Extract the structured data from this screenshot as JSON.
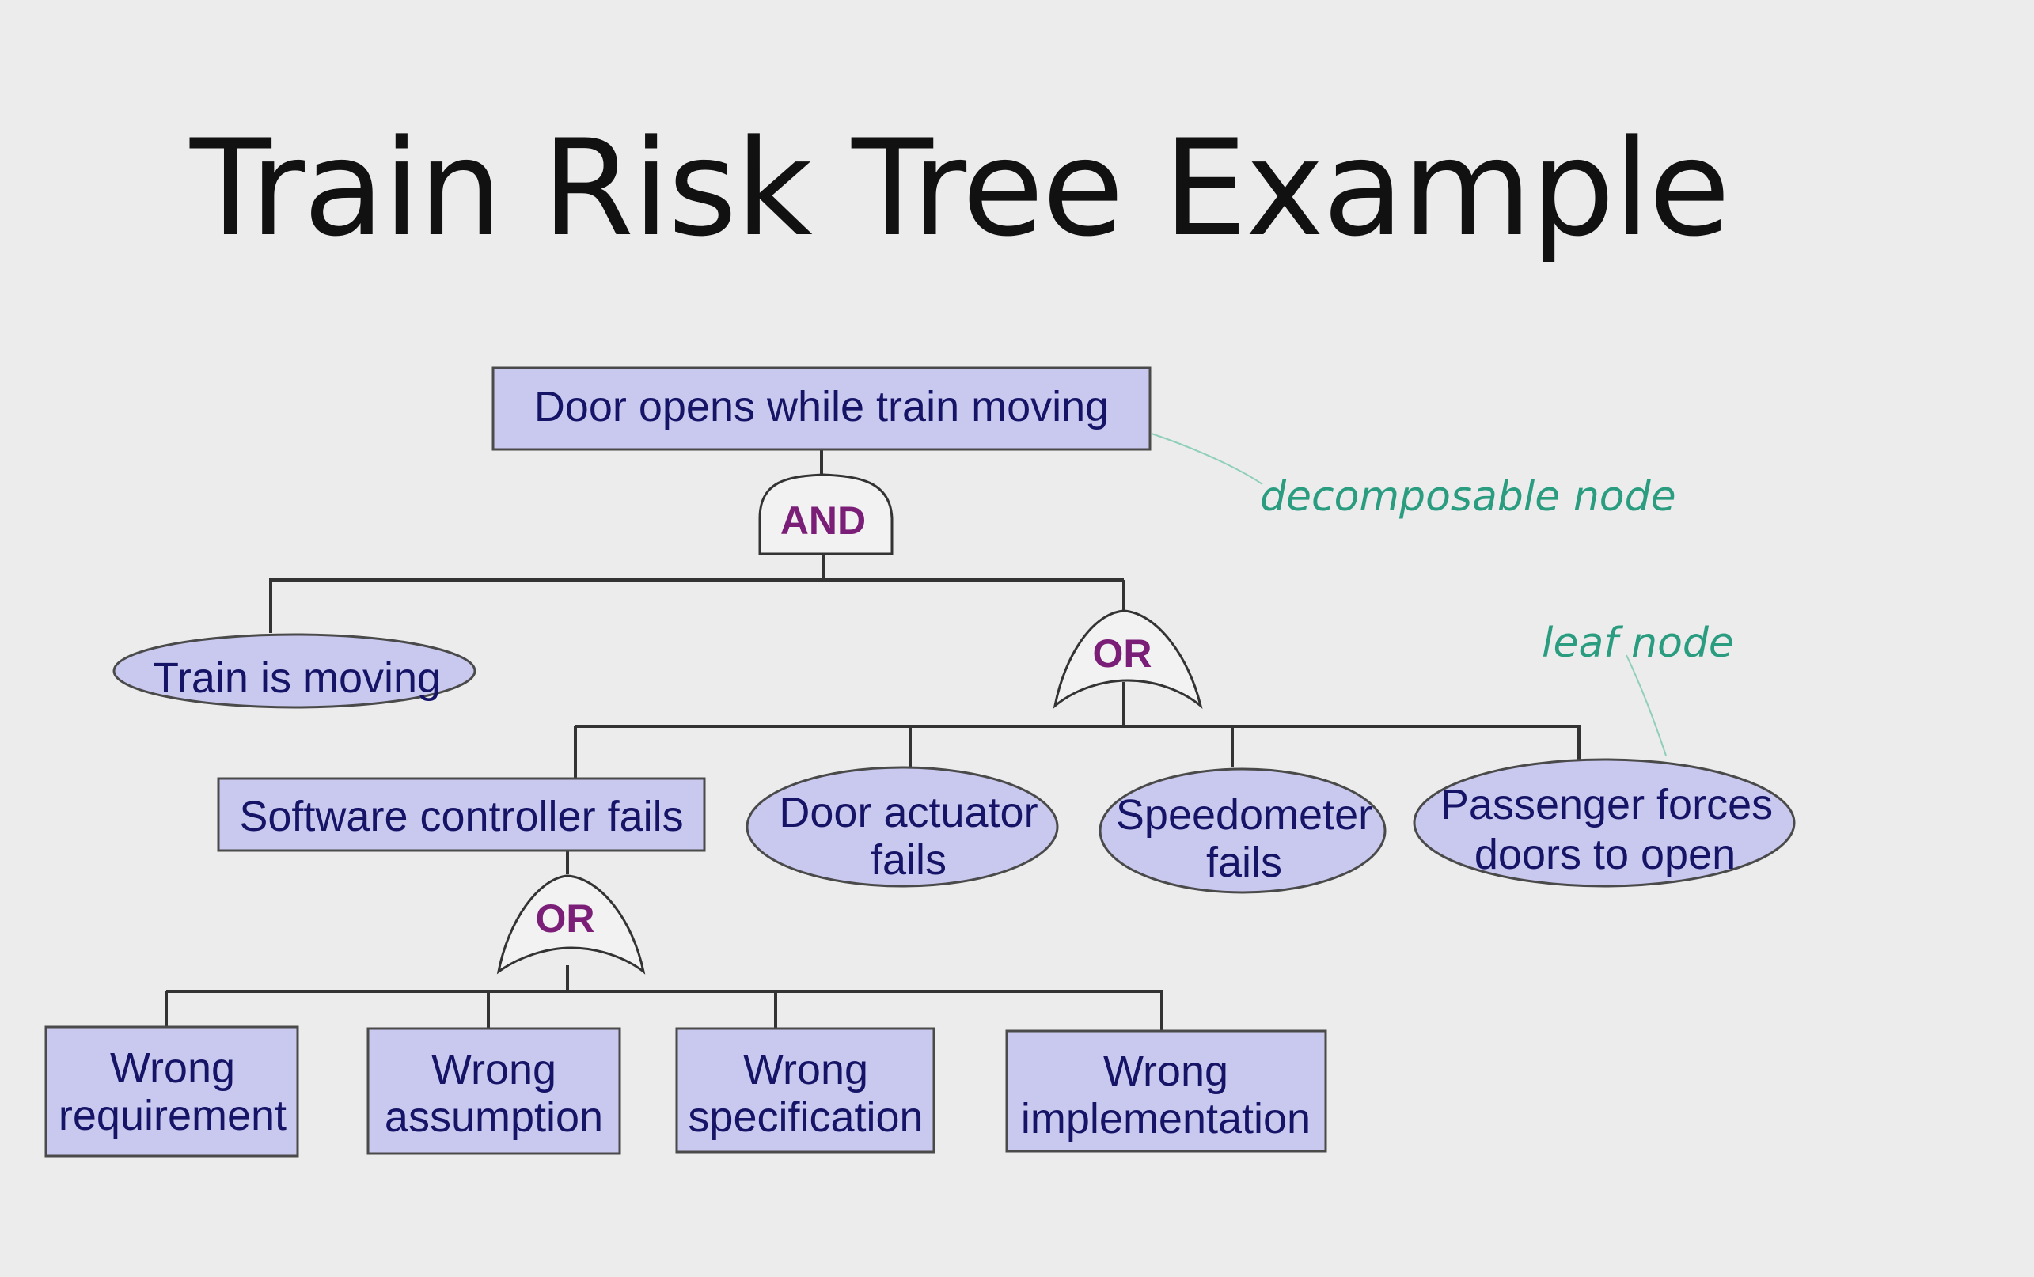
{
  "title": "Train Risk Tree Example",
  "tree": {
    "root": "Door opens while train moving",
    "gate_and": "AND",
    "gate_or_top": "OR",
    "gate_or_software": "OR",
    "train_moving": "Train is moving",
    "software_fails": "Software controller fails",
    "door_actuator": [
      "Door actuator",
      "fails"
    ],
    "speedometer": [
      "Speedometer",
      "fails"
    ],
    "passenger": [
      "Passenger forces",
      "doors to open"
    ],
    "wrong_requirement": [
      "Wrong",
      "requirement"
    ],
    "wrong_assumption": [
      "Wrong",
      "assumption"
    ],
    "wrong_specification": [
      "Wrong",
      "specification"
    ],
    "wrong_implementation": [
      "Wrong",
      "implementation"
    ]
  },
  "annotations": {
    "decomposable": "decomposable node",
    "leaf": "leaf node"
  }
}
